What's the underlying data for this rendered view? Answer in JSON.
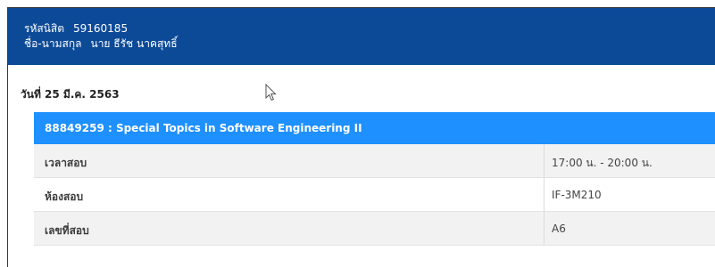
{
  "student": {
    "id_label": "รหัสนิสิต",
    "id_value": "59160185",
    "name_label": "ชื่อ-นามสกุล",
    "name_value": "นาย ธีรัช นาคสุทธิ์"
  },
  "exam_date": "วันที่ 25 มี.ค. 2563",
  "course": {
    "title": "88849259 : Special Topics in Software Engineering II"
  },
  "details": [
    {
      "label": "เวลาสอบ",
      "value": "17:00 น. - 20:00 น."
    },
    {
      "label": "ห้องสอบ",
      "value": "IF-3M210"
    },
    {
      "label": "เลขที่สอบ",
      "value": "A6"
    }
  ],
  "colors": {
    "header_bg": "#0c4a98",
    "course_bar_bg": "#1e90ff",
    "row_shade": "#f2f2f2"
  },
  "icons": {
    "cursor": "mouse-pointer-icon"
  }
}
